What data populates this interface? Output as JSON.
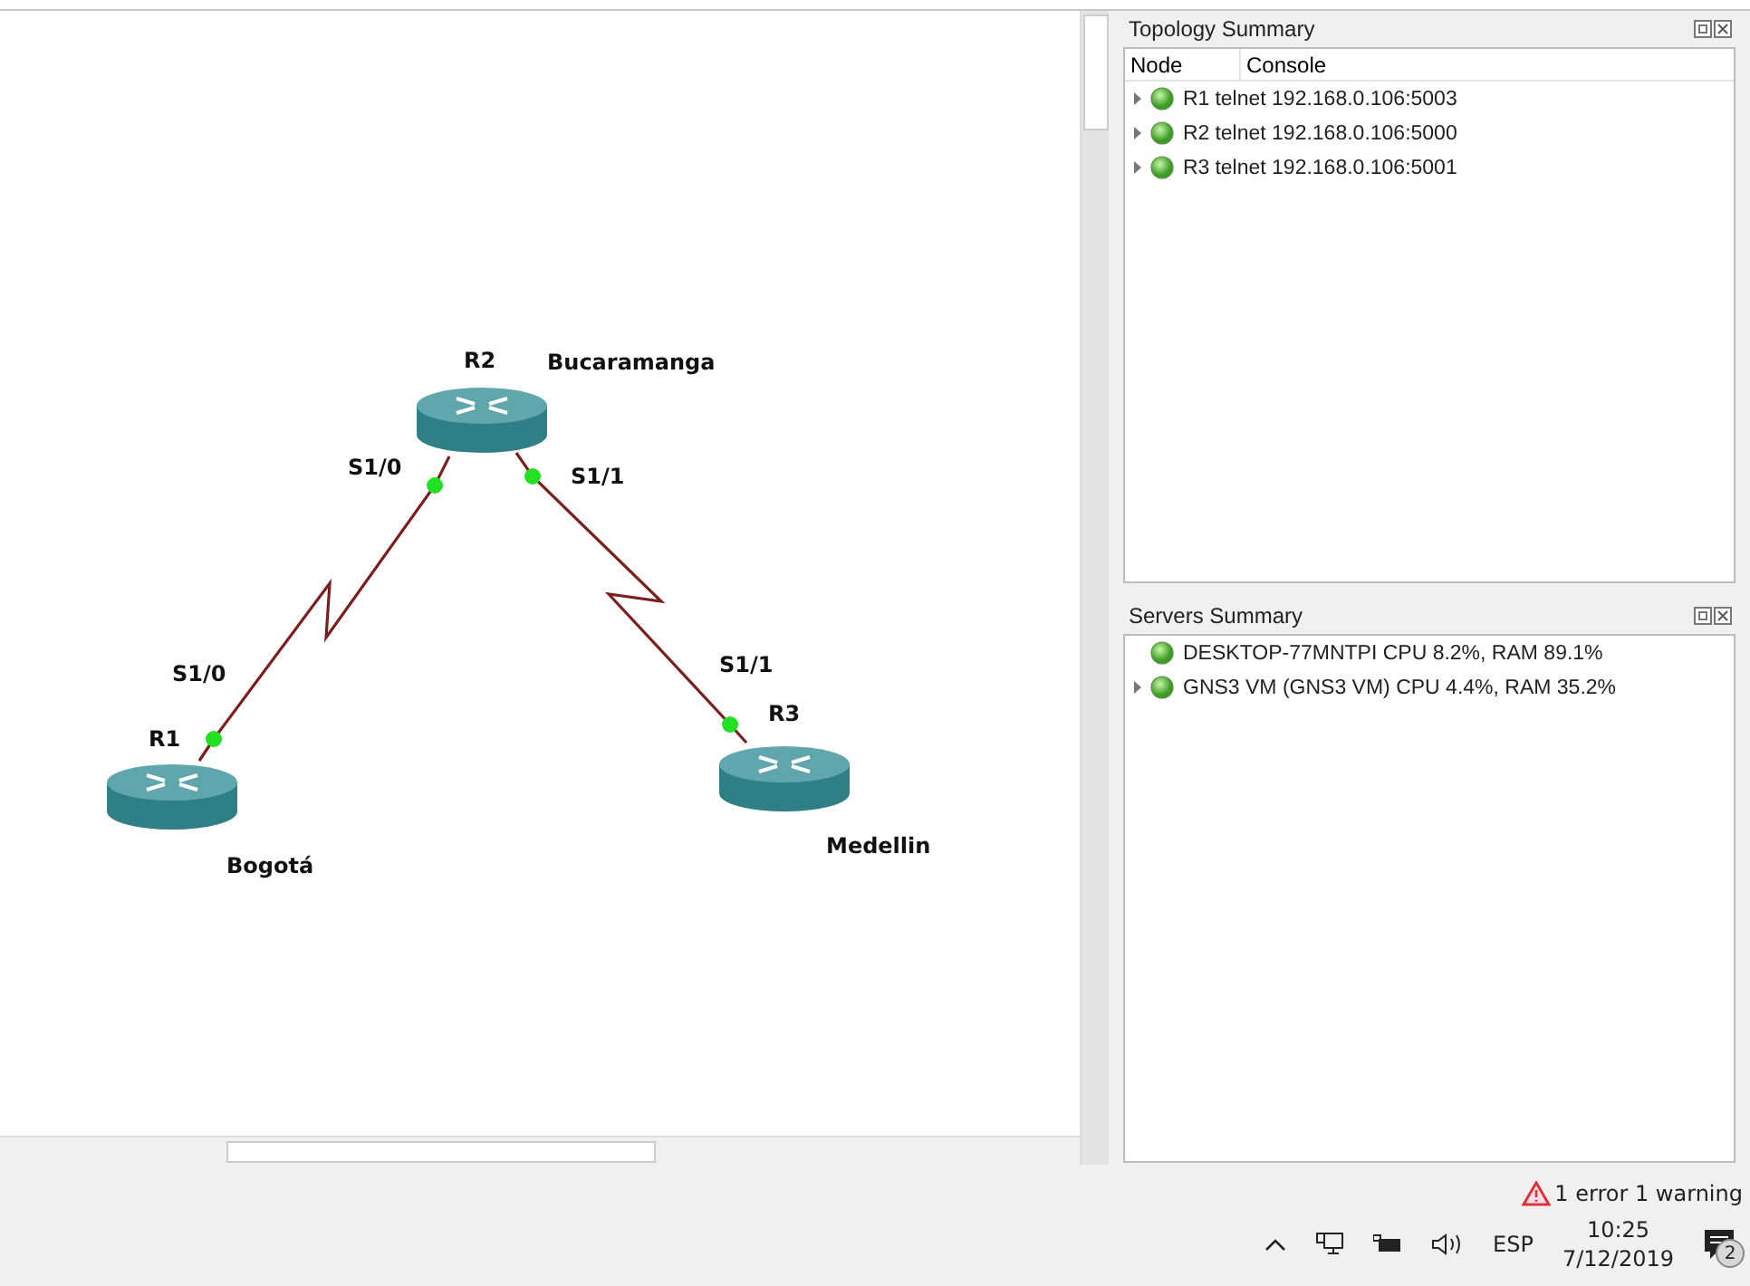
{
  "topology": {
    "nodes": [
      {
        "name": "R1",
        "location": "Bogotá"
      },
      {
        "name": "R2",
        "location": "Bucaramanga"
      },
      {
        "name": "R3",
        "location": "Medellin"
      }
    ],
    "links": [
      {
        "from_port": "S1/0",
        "to_port": "S1/0"
      },
      {
        "from_port": "S1/1",
        "to_port": "S1/1"
      }
    ]
  },
  "topology_summary": {
    "title": "Topology Summary",
    "columns": [
      "Node",
      "Console"
    ],
    "rows": [
      {
        "node": "R1",
        "console": "telnet 192.168.0.106:5003",
        "expandable": true
      },
      {
        "node": "R2",
        "console": "telnet 192.168.0.106:5000",
        "expandable": true
      },
      {
        "node": "R3",
        "console": "telnet 192.168.0.106:5001",
        "expandable": true
      }
    ]
  },
  "servers_summary": {
    "title": "Servers Summary",
    "rows": [
      {
        "text": "DESKTOP-77MNTPI CPU 8.2%, RAM 89.1%",
        "expandable": false
      },
      {
        "text": "GNS3 VM (GNS3 VM) CPU 4.4%, RAM 35.2%",
        "expandable": true
      }
    ]
  },
  "status_bar": {
    "message": "1 error 1 warning"
  },
  "taskbar": {
    "language": "ESP",
    "time": "10:25",
    "date": "7/12/2019",
    "notifications": "2"
  }
}
